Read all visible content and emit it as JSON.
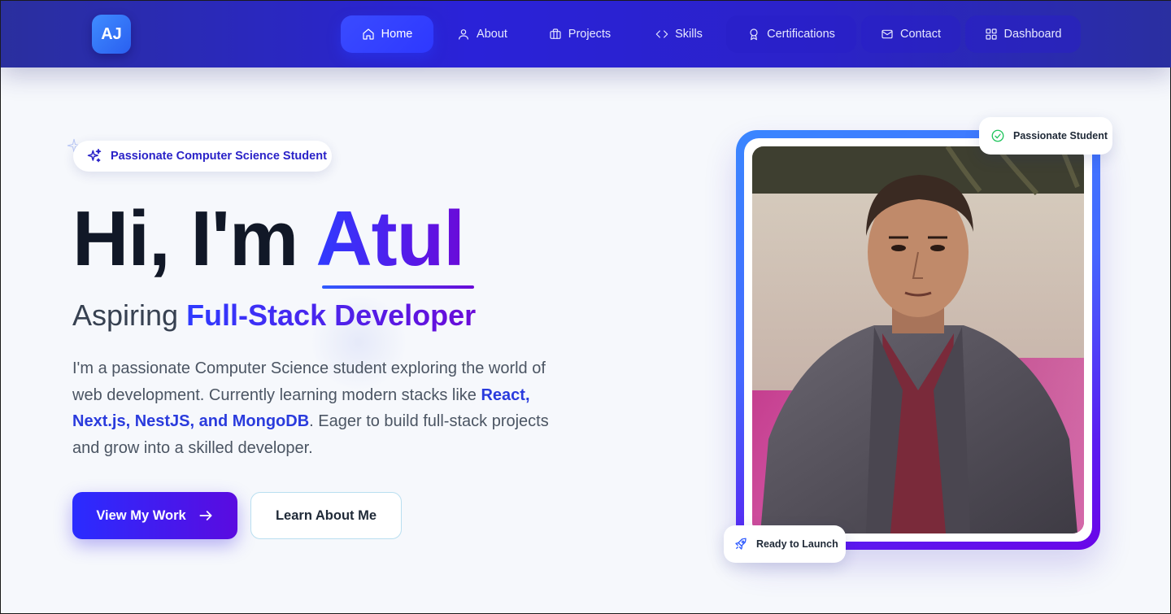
{
  "logo": {
    "text": "AJ"
  },
  "nav": {
    "items": [
      {
        "label": "Home",
        "icon": "home-icon",
        "active": true
      },
      {
        "label": "About",
        "icon": "user-icon"
      },
      {
        "label": "Projects",
        "icon": "briefcase-icon"
      },
      {
        "label": "Skills",
        "icon": "code-icon"
      },
      {
        "label": "Certifications",
        "icon": "award-icon"
      },
      {
        "label": "Contact",
        "icon": "mail-icon"
      },
      {
        "label": "Dashboard",
        "icon": "grid-icon"
      }
    ]
  },
  "hero": {
    "badge": "Passionate Computer Science Student",
    "greeting": "Hi, I'm ",
    "name": "Atul",
    "subtitle_prefix": "Aspiring ",
    "subtitle_highlight": "Full-Stack Developer",
    "desc_part1": "I'm a passionate Computer Science student exploring the world of web development. Currently learning modern stacks like ",
    "desc_highlight": "React, Next.js, NestJS, and MongoDB",
    "desc_part2": ". Eager to build full-stack projects and grow into a skilled developer.",
    "primary_button": "View My Work",
    "secondary_button": "Learn About Me"
  },
  "profile": {
    "top_badge": "Passionate Student",
    "bottom_badge": "Ready to Launch"
  },
  "colors": {
    "nav_bg": "#2a22d8",
    "accent": "#2f3bff",
    "accent_purple": "#6a0bd8",
    "success": "#22c55e",
    "text_dark": "#111827"
  }
}
